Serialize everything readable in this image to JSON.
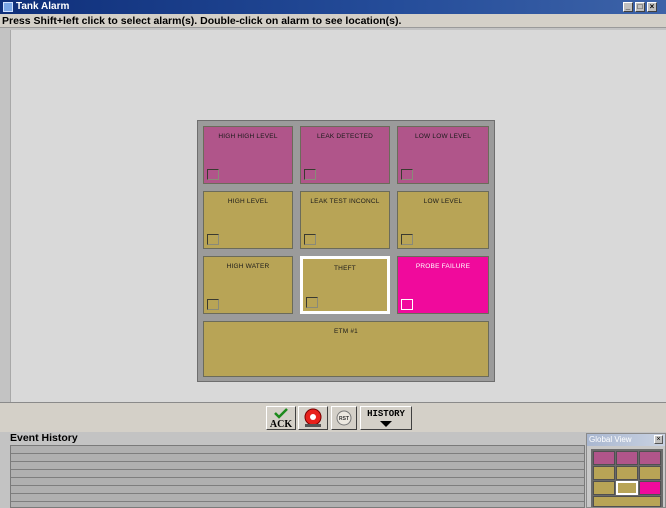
{
  "window": {
    "title": "Tank Alarm",
    "min": "_",
    "max": "□",
    "close": "×"
  },
  "instruction": "Press Shift+left click to select alarm(s). Double-click on alarm to see location(s).",
  "alarms": [
    {
      "label": "HIGH HIGH LEVEL",
      "state": "pinkdark"
    },
    {
      "label": "LEAK DETECTED",
      "state": "pinkdark"
    },
    {
      "label": "LOW LOW LEVEL",
      "state": "pinkdark"
    },
    {
      "label": "HIGH LEVEL",
      "state": "olive"
    },
    {
      "label": "LEAK TEST INCONCL",
      "state": "olive"
    },
    {
      "label": "LOW LEVEL",
      "state": "olive"
    },
    {
      "label": "HIGH WATER",
      "state": "olive"
    },
    {
      "label": "THEFT",
      "state": "olive",
      "selected": true
    },
    {
      "label": "PROBE FAILURE",
      "state": "magenta"
    },
    {
      "label": "ETM #1",
      "state": "olive"
    }
  ],
  "toolbar": {
    "ack": "ACK",
    "history": "HISTORY",
    "small_label": "RST"
  },
  "event_history": {
    "title": "Event History"
  },
  "global_view": {
    "title": "Global View",
    "close": "×"
  },
  "colors": {
    "pinkdark": "#b0558a",
    "olive": "#b8a456",
    "magenta": "#f00a9c"
  }
}
